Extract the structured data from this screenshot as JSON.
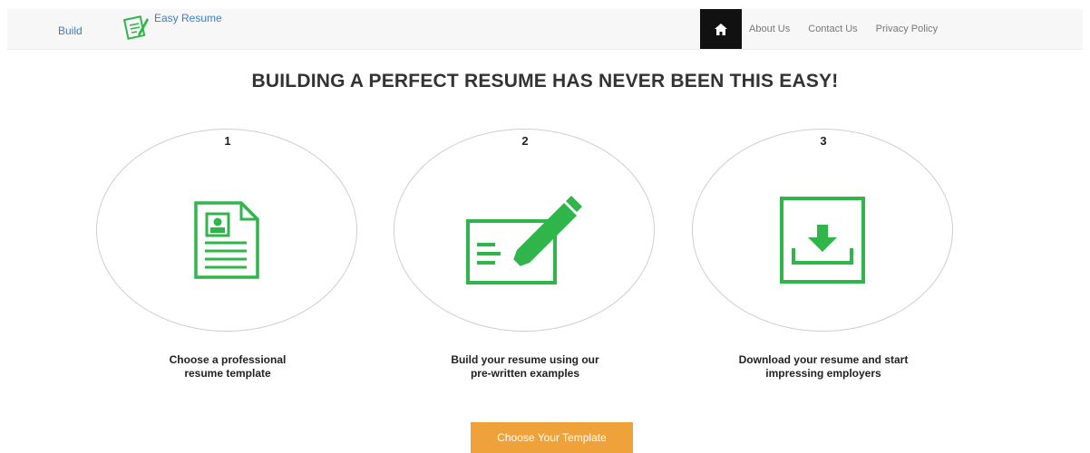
{
  "nav": {
    "left_link": "Build",
    "brand": "Easy Resume",
    "links": [
      "About Us",
      "Contact Us",
      "Privacy Policy"
    ]
  },
  "headline": "BUILDING A PERFECT RESUME HAS NEVER BEEN THIS EASY!",
  "steps": [
    {
      "number": "1",
      "caption_line1": "Choose a professional",
      "caption_line2": "resume template",
      "icon": "resume-document-icon"
    },
    {
      "number": "2",
      "caption_line1": "Build your resume using our",
      "caption_line2": "pre-written examples",
      "icon": "edit-card-icon"
    },
    {
      "number": "3",
      "caption_line1": "Download your resume and start",
      "caption_line2": "impressing employers",
      "icon": "download-icon"
    }
  ],
  "cta_label": "Choose Your Template",
  "colors": {
    "accent_green": "#2fb54a",
    "link_blue": "#3b7fc4",
    "cta_orange": "#f0a23a",
    "home_bg": "#111111"
  }
}
